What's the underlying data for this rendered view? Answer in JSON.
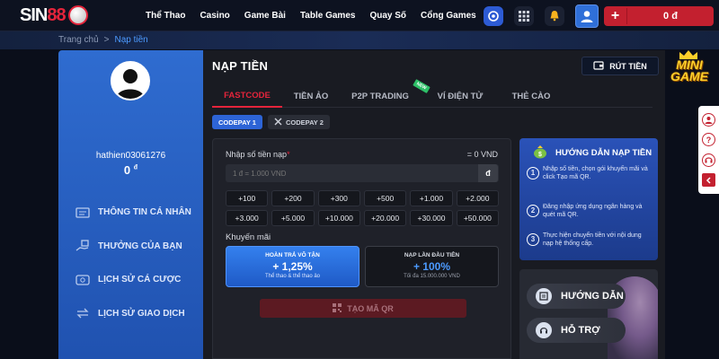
{
  "brand": {
    "logo_text_a": "SIN",
    "logo_text_b": "88"
  },
  "nav": [
    "Thể Thao",
    "Casino",
    "Game Bài",
    "Table Games",
    "Quay Số",
    "Cổng Games"
  ],
  "header": {
    "balance": "0 đ"
  },
  "breadcrumb": {
    "home": "Trang chủ",
    "separator": ">",
    "current": "Nạp tiền"
  },
  "profile": {
    "username": "hathien03061276",
    "balance": "0",
    "currency": "đ"
  },
  "sidebar": {
    "items": [
      {
        "label": "THÔNG TIN CÁ NHÂN"
      },
      {
        "label": "THƯỞNG CỦA BẠN"
      },
      {
        "label": "LỊCH SỬ CÁ CƯỢC"
      },
      {
        "label": "LỊCH SỬ GIAO DỊCH"
      }
    ]
  },
  "main": {
    "title": "NẠP TIỀN",
    "withdraw_label": "RÚT TIỀN",
    "tabs": [
      {
        "label": "FASTCODE",
        "active": true
      },
      {
        "label": "TIỀN ẢO",
        "active": false
      },
      {
        "label": "P2P TRADING",
        "active": false,
        "badge": "NEW"
      },
      {
        "label": "VÍ ĐIỆN TỬ",
        "active": false
      },
      {
        "label": "THẺ CÀO",
        "active": false
      }
    ],
    "subtabs": [
      {
        "label": "CODEPAY 1",
        "active": true
      },
      {
        "label": "CODEPAY 2",
        "active": false
      }
    ]
  },
  "form": {
    "amount_label": "Nhập số tiền nạp",
    "amount_required": "*",
    "amount_equiv": "= 0 VND",
    "amount_placeholder": "1 đ = 1.000 VND",
    "amount_unit": "đ",
    "quick_amounts": [
      "+100",
      "+200",
      "+300",
      "+500",
      "+1.000",
      "+2.000",
      "+3.000",
      "+5.000",
      "+10.000",
      "+20.000",
      "+30.000",
      "+50.000"
    ],
    "promo_label": "Khuyến mãi",
    "promos": [
      {
        "title": "HOÀN TRẢ VÔ TẬN",
        "value": "+ 1,25%",
        "sub": "Thể thao & thể thao ảo",
        "selected": true
      },
      {
        "title": "NẠP LẦN ĐẦU TIÊN",
        "value": "+ 100%",
        "sub": "Tối đa 15.000.000 VND",
        "selected": false
      }
    ],
    "submit_label": "TẠO MÃ QR"
  },
  "guide": {
    "title": "HƯỚNG DẪN NẠP TIỀN",
    "steps": [
      {
        "num": "1",
        "text": "Nhập số tiền, chọn gói khuyến mãi và click Tạo mã QR."
      },
      {
        "num": "2",
        "text": "Đăng nhập ứng dụng ngân hàng và quét mã QR."
      },
      {
        "num": "3",
        "text": "Thực hiện chuyển tiền với nội dung nạp hệ thống cấp."
      }
    ]
  },
  "support": {
    "guide_label": "HƯỚNG DẪN",
    "help_label": "HỖ TRỢ"
  },
  "minigame": {
    "line1": "MINI",
    "line2": "GAME"
  },
  "colors": {
    "accent_red": "#e5243b",
    "primary_blue": "#2f6cd0",
    "panel_dark": "#191b22"
  }
}
